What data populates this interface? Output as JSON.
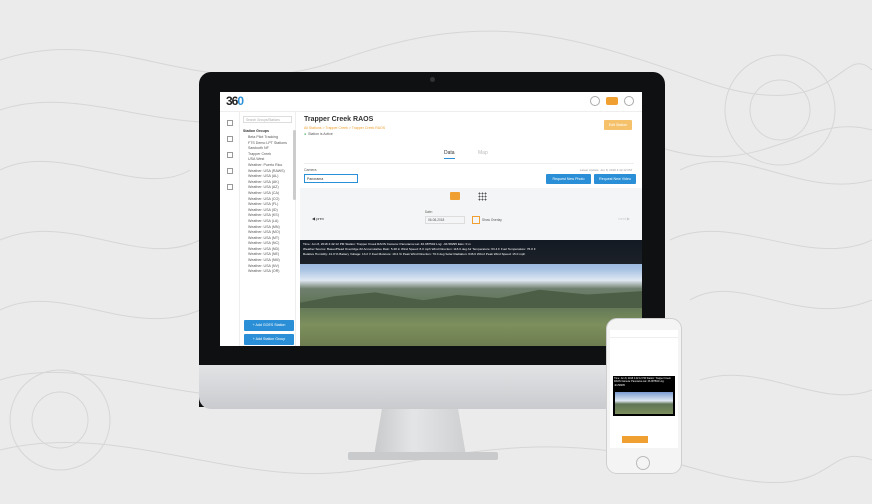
{
  "app": {
    "logo": "360",
    "search_placeholder": "Search Groups/Stations",
    "group_title": "Station Groups",
    "stations": [
      "Beta Pilot Tracking",
      "FTS Demo LPT Stations",
      "Sawtooth NF",
      "Trapper Creek",
      "USA West",
      "Weather: Puerto Rico",
      "Weather: USA (RAWS)",
      "Weather: USA (AL)",
      "Weather: USA (AK)",
      "Weather: USA (AZ)",
      "Weather: USA (CA)",
      "Weather: USA (CO)",
      "Weather: USA (FL)",
      "Weather: USA (ID)",
      "Weather: USA (KS)",
      "Weather: USA (LA)",
      "Weather: USA (MN)",
      "Weather: USA (MO)",
      "Weather: USA (MT)",
      "Weather: USA (NC)",
      "Weather: USA (ND)",
      "Weather: USA (NE)",
      "Weather: USA (NM)",
      "Weather: USA (NV)",
      "Weather: USA (OR)"
    ],
    "add_goes_label": "+ Add GOES Station",
    "add_group_label": "+ Add Station Group"
  },
  "main": {
    "title": "Trapper Creek RAOS",
    "breadcrumb": "All Stations > Trapper Creek > Trapper Creek RAOS",
    "status": "Station is Active",
    "edit_label": "Edit Station",
    "tabs": [
      "Data",
      "Map"
    ],
    "camera_label": "Camera",
    "camera_value": "Panorama",
    "last_updated": "Latest Update: Jun 8, 2018 4:42:12 PM",
    "request_photo_label": "Request New Photo",
    "request_video_label": "Request New Video",
    "date_label": "Date:",
    "date_value": "06-08-2018",
    "show_overlay_label": "Show Overlay",
    "prev_label": "prev",
    "next_label": "next",
    "overlay_lines": [
      "Time: Jun 8, 2018 4:42:12 PM     Station: Trapper Creek RAOS     Camera: Panorama     Lat: 46.087502     Lng: -94.58295     Elev: 0 m",
      "Weather Source: BaseofHead Overridge #2     Accumulative Rain: 5.48 in     Wind Speed: 8.0 mph     Wind Direction: 118.0 deg     Air Temperature: 63.4 F     Fuel Temperature: 76.0 F",
      "Relative Humidity: 41.0 %     Battery Voltage: 13.2 V     Fuel Moisture: 18.2 %     Peak Wind Direction: 76.0 deg     Solar Radiation: 646.0 W/m2     Peak Wind Speed: 15.0 mph"
    ]
  },
  "phone": {
    "overlay": "Time: Jun 8, 2018 4:42:12 PM   Station: Trapper Creek RAOS   Camera: Panorama   Lat: 46.087502   Lng: -94.58295"
  },
  "colors": {
    "accent": "#2a8fd6",
    "orange": "#f0a030"
  }
}
